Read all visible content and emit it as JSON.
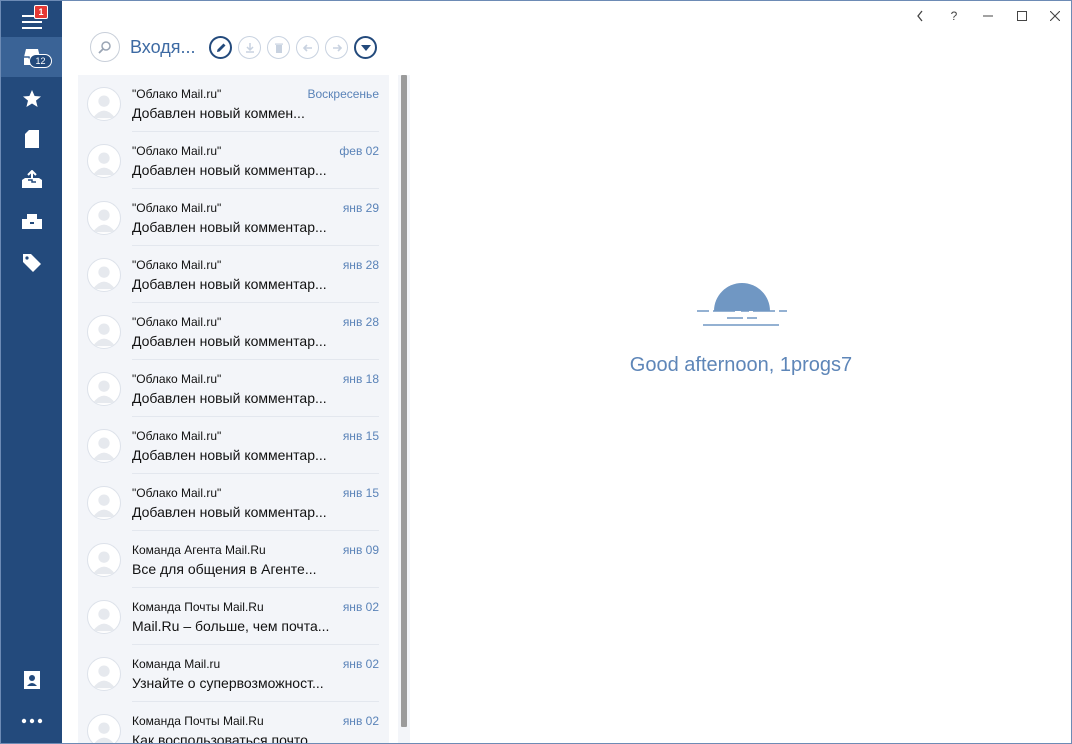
{
  "rail": {
    "menu_badge": "1",
    "inbox_badge": "12"
  },
  "toolbar": {
    "folder_title": "Входя..."
  },
  "messages": [
    {
      "sender": "\"Облако Mail.ru\"",
      "subject": "Добавлен новый коммен...",
      "date": "Воскресенье",
      "unread": true
    },
    {
      "sender": "\"Облако Mail.ru\"",
      "subject": "Добавлен новый комментар...",
      "date": "фев 02",
      "unread": true
    },
    {
      "sender": "\"Облако Mail.ru\"",
      "subject": "Добавлен новый комментар...",
      "date": "янв 29",
      "unread": true
    },
    {
      "sender": "\"Облако Mail.ru\"",
      "subject": "Добавлен новый комментар...",
      "date": "янв 28",
      "unread": true
    },
    {
      "sender": "\"Облако Mail.ru\"",
      "subject": "Добавлен новый комментар...",
      "date": "янв 28",
      "unread": true
    },
    {
      "sender": "\"Облако Mail.ru\"",
      "subject": "Добавлен новый комментар...",
      "date": "янв 18",
      "unread": true
    },
    {
      "sender": "\"Облако Mail.ru\"",
      "subject": "Добавлен новый комментар...",
      "date": "янв 15",
      "unread": true
    },
    {
      "sender": "\"Облако Mail.ru\"",
      "subject": "Добавлен новый комментар...",
      "date": "янв 15",
      "unread": true
    },
    {
      "sender": "Команда Агента Mail.Ru",
      "subject": "Все для общения в Агенте...",
      "date": "янв 09",
      "unread": true
    },
    {
      "sender": "Команда Почты Mail.Ru",
      "subject": "Mail.Ru – больше, чем почта...",
      "date": "янв 02",
      "unread": true
    },
    {
      "sender": "Команда Mail.ru",
      "subject": "Узнайте о супервозможност...",
      "date": "янв 02",
      "unread": true
    },
    {
      "sender": "Команда Почты Mail.Ru",
      "subject": "Как воспользоваться почто...",
      "date": "янв 02",
      "unread": true
    }
  ],
  "window_controls": {
    "back": "<",
    "help": "?"
  },
  "reading_pane": {
    "greeting": "Good afternoon, 1progs7"
  },
  "colors": {
    "rail": "#234a7c",
    "accent": "#5e86b8",
    "unread_dot": "#1f65c2"
  }
}
